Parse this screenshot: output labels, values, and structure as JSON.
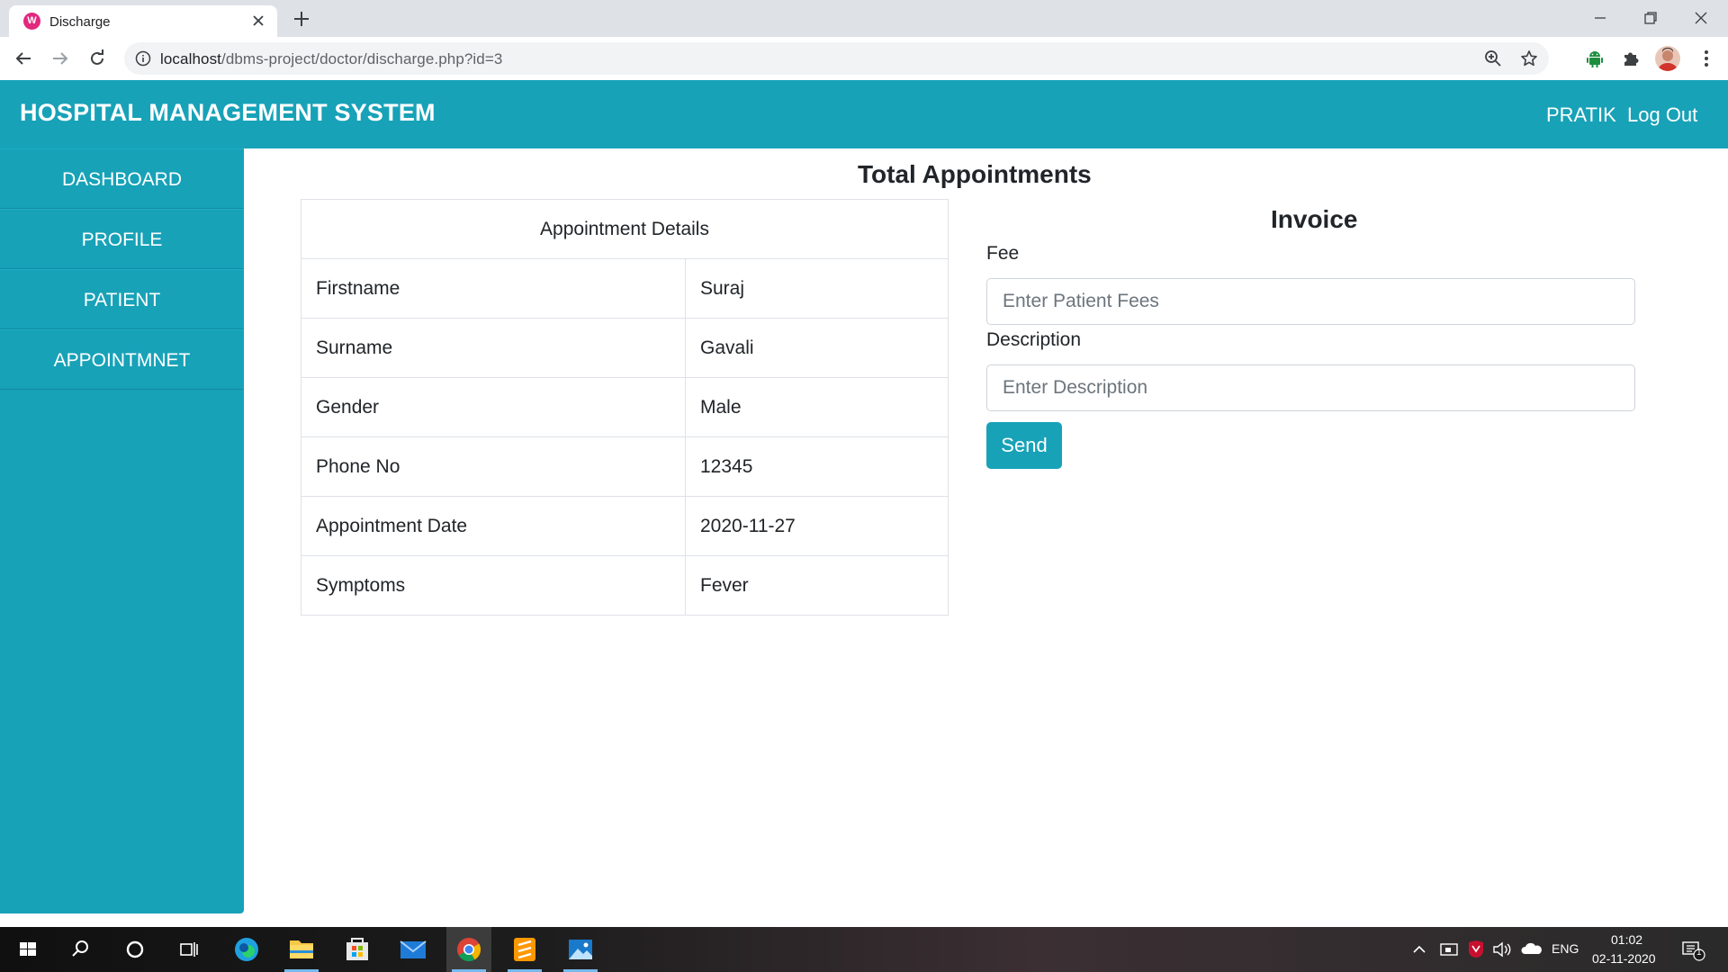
{
  "browser": {
    "tab_title": "Discharge",
    "favicon_letter": "W",
    "url_host": "localhost",
    "url_path": "/dbms-project/doctor/discharge.php?id=3"
  },
  "header": {
    "brand": "HOSPITAL MANAGEMENT SYSTEM",
    "user_name": "PRATIK",
    "logout_label": "Log Out"
  },
  "sidebar": {
    "items": [
      {
        "label": "DASHBOARD"
      },
      {
        "label": "PROFILE"
      },
      {
        "label": "PATIENT"
      },
      {
        "label": "APPOINTMNET"
      }
    ]
  },
  "main": {
    "heading": "Total Appointments",
    "table": {
      "header": "Appointment Details",
      "rows": [
        {
          "key": "Firstname",
          "value": "Suraj"
        },
        {
          "key": "Surname",
          "value": "Gavali"
        },
        {
          "key": "Gender",
          "value": "Male"
        },
        {
          "key": "Phone No",
          "value": "12345"
        },
        {
          "key": "Appointment Date",
          "value": "2020-11-27"
        },
        {
          "key": "Symptoms",
          "value": "Fever"
        }
      ]
    }
  },
  "invoice": {
    "title": "Invoice",
    "fee_label": "Fee",
    "fee_placeholder": "Enter Patient Fees",
    "description_label": "Description",
    "description_placeholder": "Enter Description",
    "send_label": "Send"
  },
  "taskbar": {
    "language": "ENG",
    "time": "01:02",
    "date": "02-11-2020",
    "notification_count": "1"
  },
  "colors": {
    "accent": "#17a2b8",
    "tab_strip": "#dee1e6"
  }
}
